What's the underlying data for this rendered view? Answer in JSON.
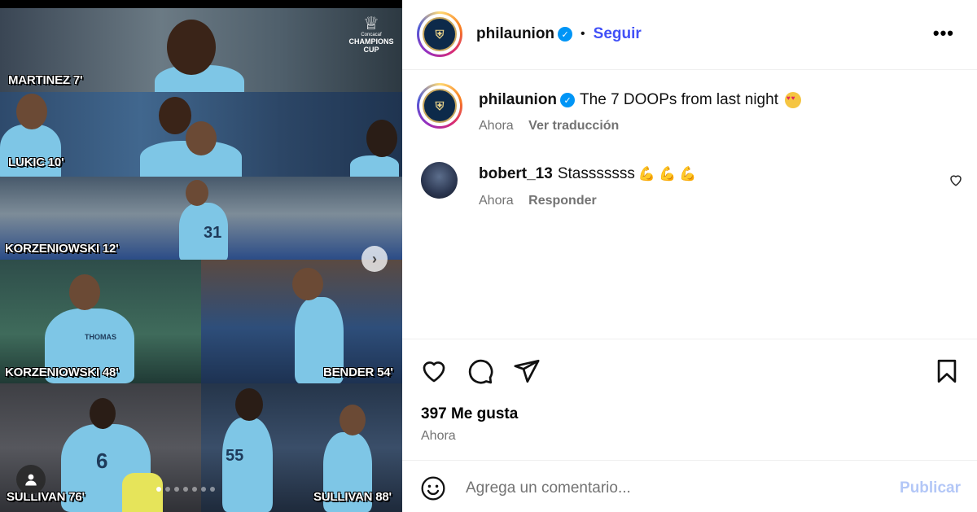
{
  "media": {
    "logo": {
      "small": "Concacaf",
      "line1": "CHAMPIONS",
      "line2": "CUP"
    },
    "captions": [
      "MARTINEZ 7'",
      "LUKIC 10'",
      "KORZENIOWSKI 12'",
      "KORZENIOWSKI 48'",
      "BENDER 54'",
      "SULLIVAN 76'",
      "SULLIVAN 88'"
    ],
    "jersey_numbers": [
      "31",
      "6",
      "55"
    ],
    "sponsor": "THOMAS",
    "next_glyph": "›",
    "carousel_dots": 7,
    "active_dot": 0
  },
  "header": {
    "username": "philaunion",
    "verified_glyph": "✓",
    "separator": "•",
    "follow_label": "Seguir",
    "more_glyph": "•••"
  },
  "caption": {
    "username": "philaunion",
    "text": "The 7 DOOPs from last night",
    "time": "Ahora",
    "translate_label": "Ver traducción"
  },
  "comment": {
    "username": "bobert_13",
    "text": "Stasssssss",
    "time": "Ahora",
    "reply_label": "Responder"
  },
  "stats": {
    "likes": "397 Me gusta",
    "time": "Ahora"
  },
  "composer": {
    "placeholder": "Agrega un comentario...",
    "publish_label": "Publicar"
  },
  "colors": {
    "follow": "#4150f7",
    "verified": "#0095f6",
    "publish_disabled": "#b3c7f7",
    "muted": "#737373"
  }
}
